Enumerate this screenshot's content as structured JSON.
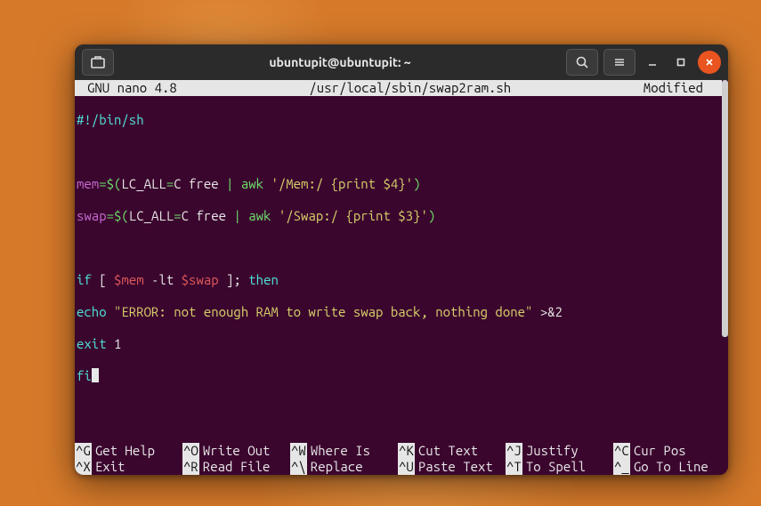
{
  "window": {
    "title": "ubuntupit@ubuntupit: ~"
  },
  "nano": {
    "app": "GNU nano 4.8",
    "file": "/usr/local/sbin/swap2ram.sh",
    "status": "Modified"
  },
  "code": {
    "l1": "#!/bin/sh",
    "l3_a": "mem",
    "l3_b": "=$(",
    "l3_c": "LC_ALL",
    "l3_d": "=",
    "l3_e": "C free ",
    "l3_f": "|",
    "l3_g": " awk ",
    "l3_h": "'/Mem:/ {print $4}'",
    "l3_i": ")",
    "l4_a": "swap",
    "l4_b": "=$(",
    "l4_c": "LC_ALL",
    "l4_d": "=",
    "l4_e": "C free ",
    "l4_f": "|",
    "l4_g": " awk ",
    "l4_h": "'/Swap:/ {print $3}'",
    "l4_i": ")",
    "l6_a": "if",
    "l6_b": " [ ",
    "l6_c": "$mem",
    "l6_d": " -lt ",
    "l6_e": "$swap",
    "l6_f": " ]; ",
    "l6_g": "then",
    "l7_a": "echo",
    "l7_b": " ",
    "l7_c": "\"ERROR: not enough RAM to write swap back, nothing done\"",
    "l7_d": " >&",
    "l7_e": "2",
    "l8_a": "exit",
    "l8_b": " 1",
    "l9_a": "fi"
  },
  "shortcuts": {
    "r1": [
      {
        "key": "^G",
        "label": "Get Help"
      },
      {
        "key": "^O",
        "label": "Write Out"
      },
      {
        "key": "^W",
        "label": "Where Is"
      },
      {
        "key": "^K",
        "label": "Cut Text"
      },
      {
        "key": "^J",
        "label": "Justify"
      },
      {
        "key": "^C",
        "label": "Cur Pos"
      }
    ],
    "r2": [
      {
        "key": "^X",
        "label": "Exit"
      },
      {
        "key": "^R",
        "label": "Read File"
      },
      {
        "key": "^\\",
        "label": "Replace"
      },
      {
        "key": "^U",
        "label": "Paste Text"
      },
      {
        "key": "^T",
        "label": "To Spell"
      },
      {
        "key": "^_",
        "label": "Go To Line"
      }
    ]
  }
}
